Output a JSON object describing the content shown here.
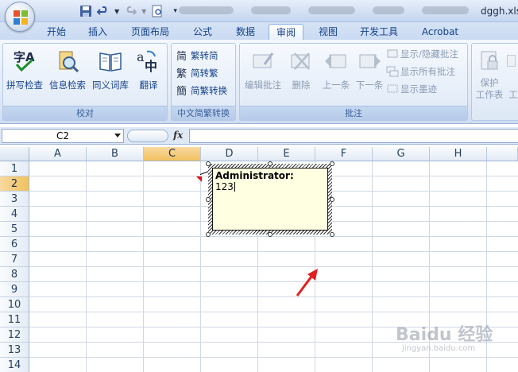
{
  "window": {
    "title": "dggh.xlsx"
  },
  "tabs": [
    "开始",
    "插入",
    "页面布局",
    "公式",
    "数据",
    "审阅",
    "视图",
    "开发工具",
    "Acrobat"
  ],
  "active_tab": "审阅",
  "ribbon": {
    "proofing": {
      "label": "校对",
      "buttons": [
        {
          "label": "拼写检查",
          "icon": "spell-check-icon"
        },
        {
          "label": "信息检索",
          "icon": "research-icon"
        },
        {
          "label": "同义词库",
          "icon": "thesaurus-icon"
        },
        {
          "label": "翻译",
          "icon": "translate-icon"
        }
      ]
    },
    "chinese_conversion": {
      "label": "中文简繁转换",
      "buttons": [
        {
          "label": "繁转简",
          "icon": "traditional-to-simplified-icon"
        },
        {
          "label": "简转繁",
          "icon": "simplified-to-traditional-icon"
        },
        {
          "label": "简繁转换",
          "icon": "convert-icon"
        }
      ]
    },
    "comments": {
      "label": "批注",
      "buttons": [
        {
          "label": "编辑批注",
          "icon": "edit-comment-icon"
        },
        {
          "label": "删除",
          "icon": "delete-comment-icon"
        },
        {
          "label": "上一条",
          "icon": "previous-comment-icon"
        },
        {
          "label": "下一条",
          "icon": "next-comment-icon"
        }
      ],
      "options": [
        {
          "label": "显示/隐藏批注",
          "icon": "show-hide-comment-icon"
        },
        {
          "label": "显示所有批注",
          "icon": "show-all-comments-icon"
        },
        {
          "label": "显示墨迹",
          "icon": "show-ink-icon"
        }
      ]
    },
    "changes": {
      "protect_label_1": "保护",
      "protect_label_2": "工作表",
      "partial_label": "工"
    }
  },
  "formula_bar": {
    "name_box": "C2",
    "fx": "fx",
    "value": ""
  },
  "grid": {
    "columns": [
      "A",
      "B",
      "C",
      "D",
      "E",
      "F",
      "G",
      "H"
    ],
    "rows": [
      "1",
      "2",
      "3",
      "4",
      "5",
      "6",
      "7",
      "8",
      "9",
      "10",
      "11",
      "12",
      "13",
      "14"
    ],
    "selected_column": "C",
    "selected_row": "2"
  },
  "comment": {
    "author": "Administrator:",
    "text": "123"
  },
  "watermark": {
    "main": "Baidu 经验",
    "sub": "jingyan.baidu.com"
  },
  "colors": {
    "ribbon": "#dfe9f7",
    "selected_header": "#f1c15f",
    "comment_bg": "#ffffe1",
    "arrow": "#e02020"
  }
}
